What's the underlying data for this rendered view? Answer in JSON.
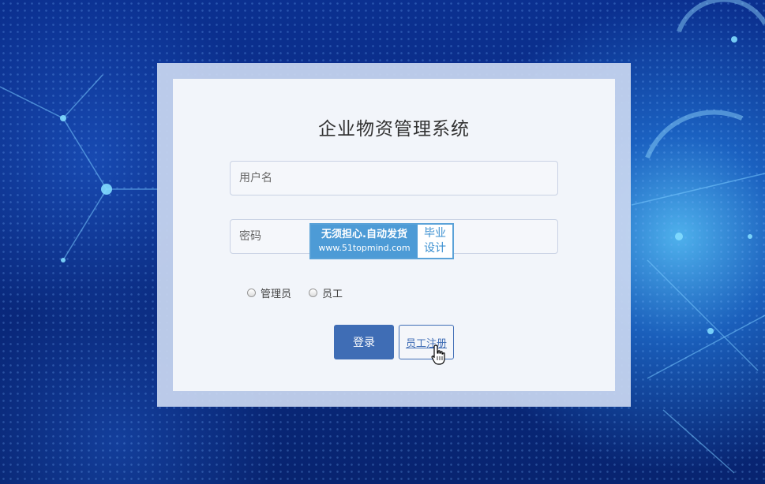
{
  "login": {
    "title": "企业物资管理系统",
    "username_placeholder": "用户名",
    "password_placeholder": "密码",
    "roles": [
      {
        "label": "管理员"
      },
      {
        "label": "员工"
      }
    ],
    "login_button": "登录",
    "register_button": "员工注册"
  },
  "watermark": {
    "line1": "无须担心.自动发货",
    "line2": "www.51topmind.com",
    "badge_line1": "毕业",
    "badge_line2": "设计"
  },
  "colors": {
    "primary": "#3f6db5",
    "watermark": "#4d9bd6"
  },
  "icons": {
    "cursor": "hand-pointer-cursor-icon"
  }
}
